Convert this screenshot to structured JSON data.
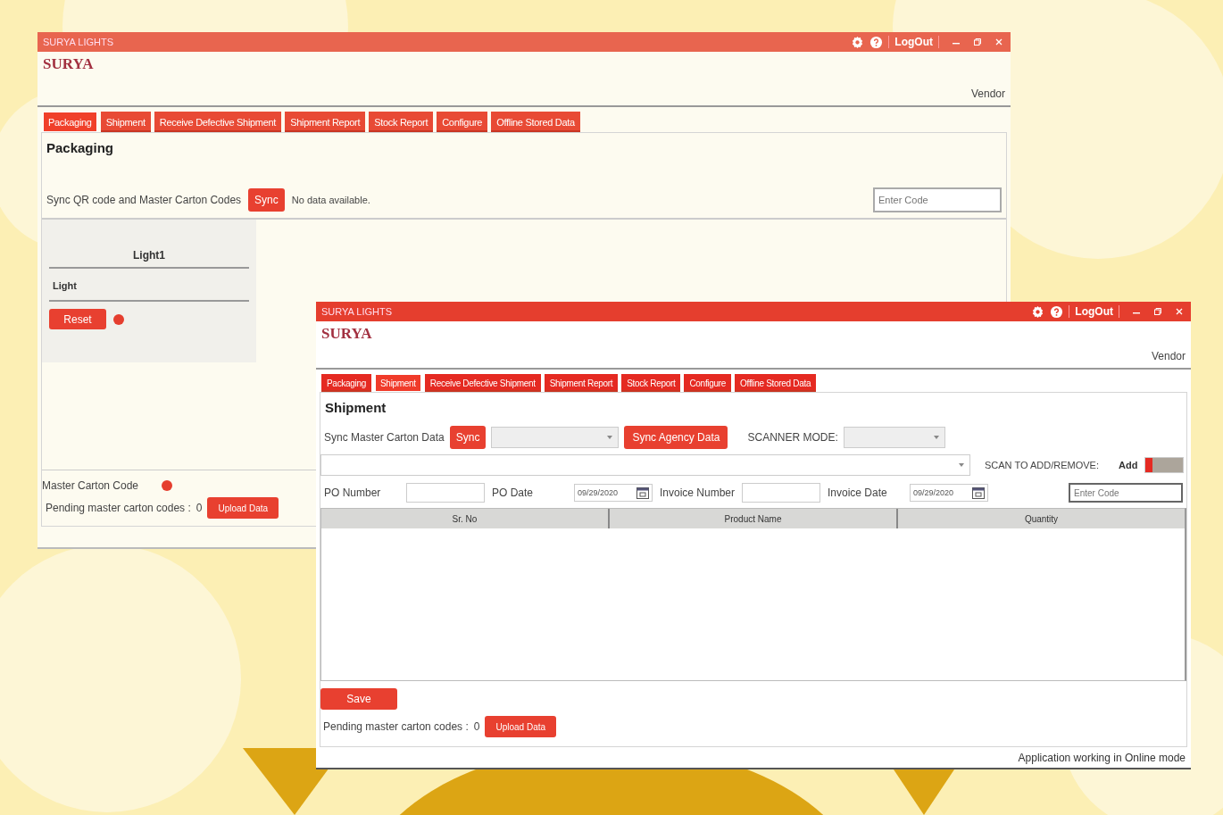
{
  "packaging_window": {
    "title": "SURYA LIGHTS",
    "logout": "LogOut",
    "logo": "SURYA",
    "role": "Vendor",
    "tabs": [
      {
        "label": "Packaging",
        "selected": true
      },
      {
        "label": "Shipment",
        "selected": false
      },
      {
        "label": "Receive Defective Shipment",
        "selected": false
      },
      {
        "label": "Shipment Report",
        "selected": false
      },
      {
        "label": "Stock Report",
        "selected": false
      },
      {
        "label": "Configure",
        "selected": false
      },
      {
        "label": "Offline Stored Data",
        "selected": false
      }
    ],
    "heading": "Packaging",
    "sync_label": "Sync QR code and Master Carton Codes",
    "sync_button": "Sync",
    "sync_status": "No data available.",
    "code_field": {
      "placeholder": "Enter Code"
    },
    "card": {
      "title": "Light1",
      "item": "Light",
      "reset_button": "Reset"
    },
    "master_carton_label": "Master Carton Code",
    "pending_label": "Pending master carton codes :",
    "pending_count": "0",
    "upload_button": "Upload Data"
  },
  "shipment_window": {
    "title": "SURYA LIGHTS",
    "logout": "LogOut",
    "logo": "SURYA",
    "role": "Vendor",
    "tabs": [
      {
        "label": "Packaging",
        "selected": false
      },
      {
        "label": "Shipment",
        "selected": true
      },
      {
        "label": "Receive Defective Shipment",
        "selected": false
      },
      {
        "label": "Shipment Report",
        "selected": false
      },
      {
        "label": "Stock Report",
        "selected": false
      },
      {
        "label": "Configure",
        "selected": false
      },
      {
        "label": "Offline Stored Data",
        "selected": false
      }
    ],
    "heading": "Shipment",
    "sync_label": "Sync Master Carton Data",
    "sync_button": "Sync",
    "agency_button": "Sync Agency Data",
    "scanner_label": "SCANNER MODE:",
    "scan_label": "SCAN TO ADD/REMOVE:",
    "toggle": {
      "label": "Add",
      "on": true
    },
    "po_number_label": "PO Number",
    "po_date_label": "PO Date",
    "po_date": "09/29/2020",
    "invoice_number_label": "Invoice Number",
    "invoice_date_label": "Invoice Date",
    "invoice_date": "09/29/2020",
    "code_field": {
      "placeholder": "Enter Code"
    },
    "columns": [
      "Sr. No",
      "Product Name",
      "Quantity"
    ],
    "save_button": "Save",
    "pending_label": "Pending master carton codes :",
    "pending_count": "0",
    "upload_button": "Upload Data",
    "status": "Application working in Online mode"
  }
}
